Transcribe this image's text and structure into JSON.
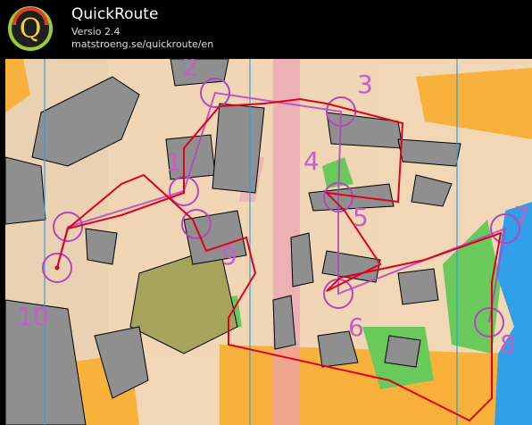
{
  "app": {
    "title": "QuickRoute",
    "version": "Versio 2.4",
    "url": "matstroeng.se/quickroute/en",
    "logo_letter": "Q"
  },
  "colors": {
    "course": "#b545c0",
    "route": "#e0001b",
    "water": "#32a0e8",
    "map_base": "#f2d7b6",
    "building": "#8f8f8f",
    "green": "#69c95b",
    "field": "#f8b13a"
  },
  "map": {
    "control_labels": [
      "1",
      "2",
      "3",
      "4",
      "5",
      "6",
      "7",
      "8",
      "9",
      "10"
    ]
  }
}
